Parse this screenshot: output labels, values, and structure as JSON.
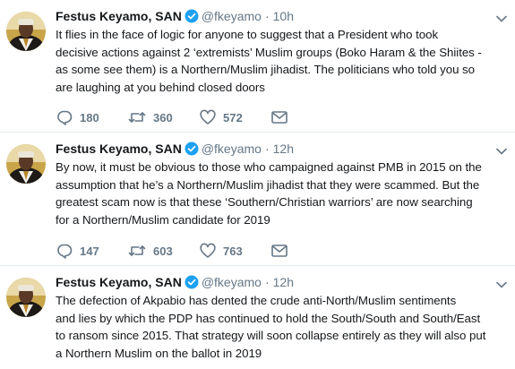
{
  "tweets": [
    {
      "author_name": "Festus Keyamo, SAN",
      "handle": "@fkeyamo",
      "time": "10h",
      "text_lines": [
        "It flies in the face of logic for anyone to suggest that a President who took",
        "decisive actions against 2 ‘extremists’ Muslim groups (Boko Haram & the Shiites -",
        "as some see them) is a Northern/Muslim jihadist. The politicians who told you so",
        "are laughing at you behind closed doors"
      ],
      "replies": "180",
      "retweets": "360",
      "likes": "572"
    },
    {
      "author_name": "Festus Keyamo, SAN",
      "handle": "@fkeyamo",
      "time": "12h",
      "text_lines": [
        "By now, it must be obvious to those who campaigned against PMB in 2015 on the",
        "assumption that he’s a Northern/Muslim jihadist that they were scammed. But the",
        "greatest scam  now is that these ‘Southern/Christian warriors’ are now searching",
        "for a Northern/Muslim candidate for 2019"
      ],
      "replies": "147",
      "retweets": "603",
      "likes": "763"
    },
    {
      "author_name": "Festus Keyamo, SAN",
      "handle": "@fkeyamo",
      "time": "12h",
      "text_lines": [
        "The defection of Akpabio has dented the crude anti-North/Muslim  sentiments",
        "and lies by which the PDP has continued to hold the South/South and South/East",
        "to ransom since 2015. That strategy will soon collapse entirely as they will also put",
        "a Northern Muslim on the ballot in 2019"
      ]
    }
  ],
  "separator": "·",
  "icons": {
    "reply": "speech-bubble-icon",
    "retweet": "retweet-icon",
    "like": "heart-icon",
    "message": "envelope-icon",
    "verified": "verified-badge-icon",
    "more": "chevron-down-icon"
  },
  "colors": {
    "verified": "#1da1f2",
    "icon": "#657786",
    "text": "#14171a",
    "divider": "#e6ecf0"
  }
}
